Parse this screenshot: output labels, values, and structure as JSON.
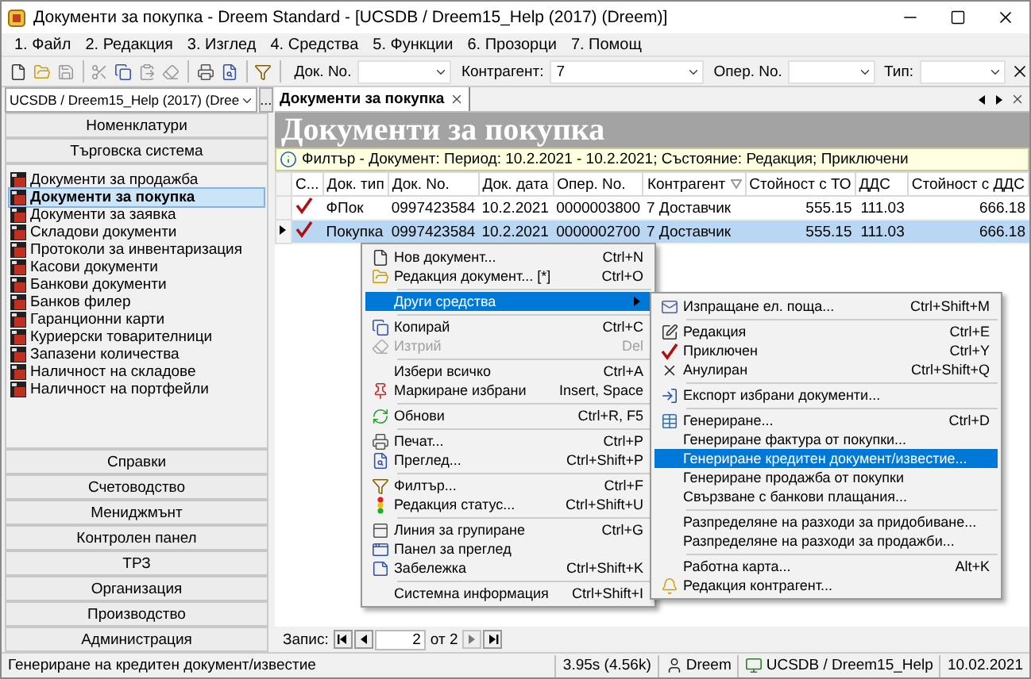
{
  "window": {
    "title": "Документи за покупка - Dreem Standard - [UCSDB / Dreem15_Help (2017) (Dreem)]"
  },
  "menu_bar": [
    "1. Файл",
    "2. Редакция",
    "3. Изглед",
    "4. Средства",
    "5. Функции",
    "6. Прозорци",
    "7. Помощ"
  ],
  "toolbar": {
    "fields": [
      {
        "label": "Док. No."
      },
      {
        "label": "Контрагент:",
        "value": "7"
      },
      {
        "label": "Опер. No."
      },
      {
        "label": "Тип:"
      }
    ]
  },
  "database_selector": {
    "value": "UCSDB / Dreem15_Help (2017) (Dree",
    "button": "..."
  },
  "tabs": [
    {
      "label": "Документи за покупка",
      "selected": true
    }
  ],
  "sidebar": {
    "top_sections": [
      "Номенклатури",
      "Търговска система"
    ],
    "items": [
      {
        "label": "Документи за продажба",
        "selected": false
      },
      {
        "label": "Документи за покупка",
        "selected": true
      },
      {
        "label": "Документи за заявка",
        "selected": false
      },
      {
        "label": "Складови документи",
        "selected": false
      },
      {
        "label": "Протоколи за инвентаризация",
        "selected": false
      },
      {
        "label": "Касови документи",
        "selected": false
      },
      {
        "label": "Банкови документи",
        "selected": false
      },
      {
        "label": "Банков филер",
        "selected": false
      },
      {
        "label": "Гаранционни карти",
        "selected": false
      },
      {
        "label": "Куриерски товарителници",
        "selected": false
      },
      {
        "label": "Запазени количества",
        "selected": false
      },
      {
        "label": "Наличност на складове",
        "selected": false
      },
      {
        "label": "Наличност на портфейли",
        "selected": false
      }
    ],
    "bottom_sections": [
      "Справки",
      "Счетоводство",
      "Мениджмънт",
      "Контролен панел",
      "ТРЗ",
      "Организация",
      "Производство",
      "Администрация"
    ]
  },
  "document_view": {
    "title": "Документи за покупка",
    "filter": "Филтър - Документ: Период: 10.2.2021 - 10.2.2021; Състояние: Редакция; Приключени",
    "table": {
      "columns": [
        {
          "label": "С...",
          "kind": "status"
        },
        {
          "label": "Док. тип",
          "kind": "text"
        },
        {
          "label": "Док. No.",
          "kind": "text"
        },
        {
          "label": "Док. дата",
          "kind": "text"
        },
        {
          "label": "Опер. No.",
          "kind": "text"
        },
        {
          "label": "Контрагент",
          "kind": "text",
          "sorted": true
        },
        {
          "label": "Стойност с ТО",
          "kind": "number"
        },
        {
          "label": "ДДС",
          "kind": "number"
        },
        {
          "label": "Стойност с ДДС",
          "kind": "number"
        }
      ],
      "rows": [
        {
          "closed": true,
          "selected": false,
          "cells": [
            "",
            "ФПок",
            "0997423584",
            "10.2.2021",
            "0000003800",
            "7 Доставчик",
            "555.15",
            "111.03",
            "666.18"
          ]
        },
        {
          "closed": true,
          "selected": true,
          "cells": [
            "",
            "Покупка",
            "0997423584",
            "10.2.2021",
            "0000002700",
            "7 Доставчик",
            "555.15",
            "111.03",
            "666.18"
          ]
        }
      ]
    },
    "record_nav": {
      "label": "Запис:",
      "current": "2",
      "total": "от 2"
    }
  },
  "context_menu": {
    "groups": [
      {
        "items": [
          {
            "label": "Нов документ...",
            "shortcut": "Ctrl+N",
            "disabled": false,
            "selected": false,
            "submenu": false
          },
          {
            "label": "Редакция документ... [*]",
            "shortcut": "Ctrl+O",
            "disabled": false,
            "selected": false,
            "submenu": false
          }
        ]
      },
      {
        "items": [
          {
            "label": "Други средства",
            "disabled": false,
            "selected": true,
            "submenu": true
          }
        ]
      },
      {
        "items": [
          {
            "label": "Копирай",
            "shortcut": "Ctrl+C",
            "disabled": false,
            "selected": false,
            "submenu": false
          },
          {
            "label": "Изтрий",
            "shortcut": "Del",
            "disabled": true,
            "selected": false,
            "submenu": false
          }
        ]
      },
      {
        "items": [
          {
            "label": "Избери всичко",
            "shortcut": "Ctrl+A",
            "disabled": false,
            "selected": false,
            "submenu": false
          },
          {
            "label": "Маркиране избрани",
            "shortcut": "Insert, Space",
            "disabled": false,
            "selected": false,
            "submenu": false
          }
        ]
      },
      {
        "items": [
          {
            "label": "Обнови",
            "shortcut": "Ctrl+R, F5",
            "disabled": false,
            "selected": false,
            "submenu": false
          }
        ]
      },
      {
        "items": [
          {
            "label": "Печат...",
            "shortcut": "Ctrl+P",
            "disabled": false,
            "selected": false,
            "submenu": false
          },
          {
            "label": "Преглед...",
            "shortcut": "Ctrl+Shift+P",
            "disabled": false,
            "selected": false,
            "submenu": false
          }
        ]
      },
      {
        "items": [
          {
            "label": "Филтър...",
            "shortcut": "Ctrl+F",
            "disabled": false,
            "selected": false,
            "submenu": false
          },
          {
            "label": "Редакция статус...",
            "shortcut": "Ctrl+Shift+U",
            "disabled": false,
            "selected": false,
            "submenu": false
          }
        ]
      },
      {
        "items": [
          {
            "label": "Линия за групиране",
            "shortcut": "Ctrl+G",
            "disabled": false,
            "selected": false,
            "submenu": false
          },
          {
            "label": "Панел за преглед",
            "disabled": false,
            "selected": false,
            "submenu": false
          },
          {
            "label": "Забележка",
            "shortcut": "Ctrl+Shift+K",
            "disabled": false,
            "selected": false,
            "submenu": false
          }
        ]
      },
      {
        "items": [
          {
            "label": "Системна информация",
            "shortcut": "Ctrl+Shift+I",
            "disabled": false,
            "selected": false,
            "submenu": false
          }
        ]
      }
    ]
  },
  "submenu": {
    "groups": [
      {
        "items": [
          {
            "label": "Изпращане ел. поща...",
            "shortcut": "Ctrl+Shift+M",
            "disabled": false,
            "selected": false,
            "submenu": false
          }
        ]
      },
      {
        "items": [
          {
            "label": "Редакция",
            "shortcut": "Ctrl+E",
            "disabled": false,
            "selected": false,
            "submenu": false
          },
          {
            "label": "Приключен",
            "shortcut": "Ctrl+Y",
            "disabled": false,
            "selected": false,
            "submenu": false
          },
          {
            "label": "Анулиран",
            "shortcut": "Ctrl+Shift+Q",
            "disabled": false,
            "selected": false,
            "submenu": false
          }
        ]
      },
      {
        "items": [
          {
            "label": "Експорт избрани документи...",
            "disabled": false,
            "selected": false,
            "submenu": false
          }
        ]
      },
      {
        "items": [
          {
            "label": "Генериране...",
            "shortcut": "Ctrl+D",
            "disabled": false,
            "selected": false,
            "submenu": false
          },
          {
            "label": "Генериране фактура от покупки...",
            "disabled": false,
            "selected": false,
            "submenu": false
          },
          {
            "label": "Генериране кредитен документ/известие...",
            "disabled": false,
            "selected": true,
            "submenu": false
          },
          {
            "label": "Генериране продажба от покупки",
            "disabled": false,
            "selected": false,
            "submenu": false
          },
          {
            "label": "Свързване с банкови плащания...",
            "disabled": false,
            "selected": false,
            "submenu": false
          }
        ]
      },
      {
        "items": [
          {
            "label": "Разпределяне на разходи за придобиване...",
            "disabled": false,
            "selected": false,
            "submenu": false
          },
          {
            "label": "Разпределяне на разходи за продажби...",
            "disabled": false,
            "selected": false,
            "submenu": false
          }
        ]
      },
      {
        "items": [
          {
            "label": "Работна карта...",
            "shortcut": "Alt+K",
            "disabled": false,
            "selected": false,
            "submenu": false
          },
          {
            "label": "Редакция контрагент...",
            "disabled": false,
            "selected": false,
            "submenu": false
          }
        ]
      }
    ]
  },
  "status_bar": {
    "message": "Генериране на кредитен документ/известие",
    "timing": "3.95s (4.56k)",
    "user": "Dreem",
    "database": "UCSDB / Dreem15_Help",
    "date": "10.02.2021"
  }
}
